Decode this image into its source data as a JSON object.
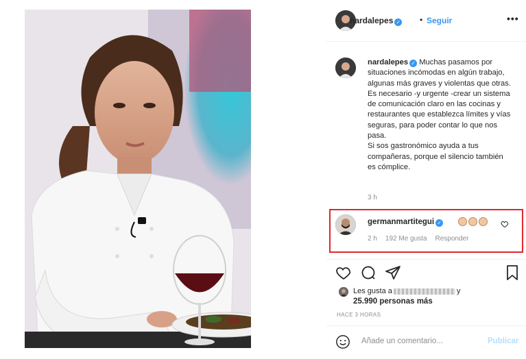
{
  "header": {
    "username": "nardalepes",
    "dot": "•",
    "follow_label": "Seguir",
    "more_label": "•••"
  },
  "caption": {
    "username": "nardalepes",
    "paragraph1": "Muchas pasamos por situaciones incómodas en algún trabajo, algunas más graves y violentas que otras.",
    "paragraph2": "Es necesario -y urgente -crear un sistema de comunicación claro en las cocinas y restaurantes que establezca límites y vías seguras, para poder contar lo que nos pasa.",
    "paragraph3": "Si sos gastronómico ayuda a tus compañeras, porque el silencio también es cómplice.",
    "time": "3 h"
  },
  "comment": {
    "username": "germanmartitegui",
    "time": "2 h",
    "likes": "192 Me gusta",
    "reply_label": "Responder"
  },
  "likes": {
    "prefix": "Les gusta a",
    "suffix": "y",
    "count_text": "25.990 personas más",
    "posted_ago": "HACE 3 HORAS"
  },
  "comment_input": {
    "placeholder": "Añade un comentario...",
    "publish_label": "Publicar"
  },
  "icons": {
    "verified": "verified-badge-icon",
    "heart": "heart-icon",
    "comment": "comment-icon",
    "share": "paper-plane-icon",
    "save": "bookmark-icon",
    "emoji": "smiley-icon"
  },
  "colors": {
    "link_blue": "#3897f0",
    "highlight_red": "#e0262c",
    "muted": "#8e8e8e",
    "publish_disabled": "#b2dffc"
  }
}
